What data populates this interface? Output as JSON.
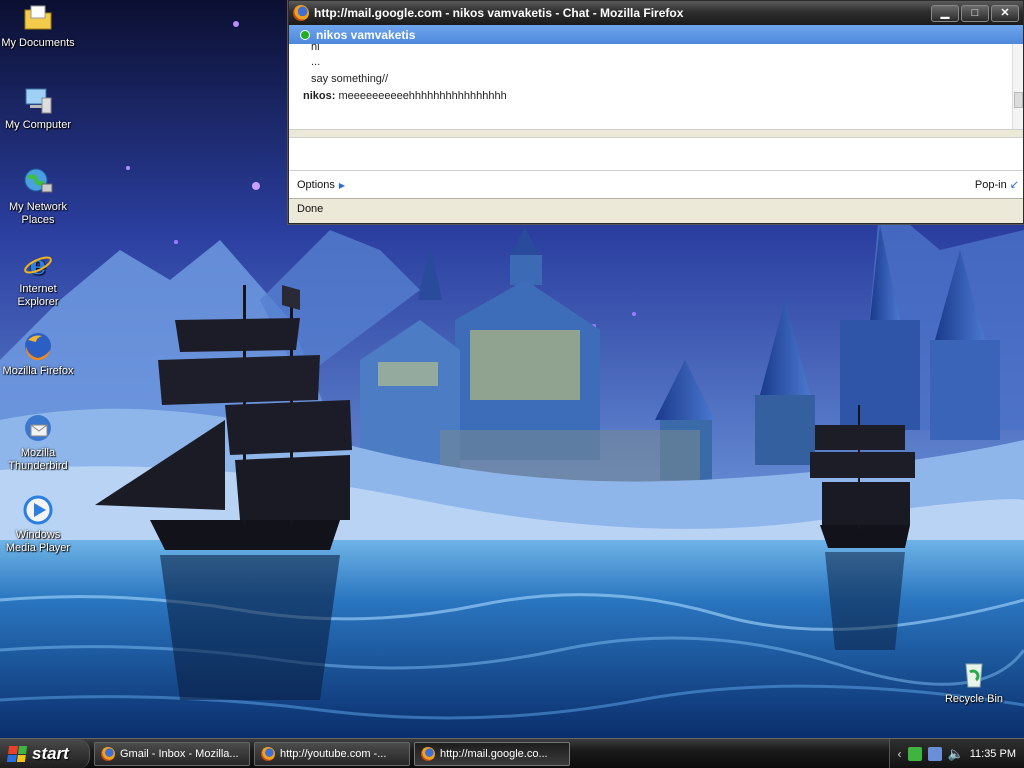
{
  "desktop": {
    "icons": [
      {
        "label": "My Documents",
        "icon": "my-documents-folder-icon"
      },
      {
        "label": "My Computer",
        "icon": "my-computer-icon"
      },
      {
        "label": "My Network Places",
        "icon": "network-places-icon"
      },
      {
        "label": "Internet Explorer",
        "icon": "internet-explorer-icon"
      },
      {
        "label": "Mozilla Firefox",
        "icon": "firefox-icon"
      },
      {
        "label": "Mozilla Thunderbird",
        "icon": "thunderbird-icon"
      },
      {
        "label": "Windows Media Player",
        "icon": "media-player-icon"
      },
      {
        "label": "Recycle Bin",
        "icon": "recycle-bin-icon"
      }
    ]
  },
  "window": {
    "title": "http://mail.google.com - nikos vamvaketis - Chat - Mozilla Firefox",
    "buttons": {
      "minimize": "▁",
      "maximize": "□",
      "close": "✕"
    },
    "chat": {
      "contact": "nikos vamvaketis",
      "status_color": "#21b021",
      "messages": [
        {
          "sender": "",
          "text": "hi"
        },
        {
          "sender": "",
          "text": "..."
        },
        {
          "sender": "",
          "text": "say something//"
        },
        {
          "sender": "nikos:",
          "text": "meeeeeeeeeehhhhhhhhhhhhhhhh"
        }
      ],
      "options_label": "Options",
      "popin_label": "Pop-in"
    },
    "status_text": "Done"
  },
  "taskbar": {
    "start_label": "start",
    "tasks": [
      {
        "label": "Gmail - Inbox - Mozilla...",
        "active": false
      },
      {
        "label": "http://youtube.com -...",
        "active": false
      },
      {
        "label": "http://mail.google.co...",
        "active": true
      }
    ],
    "clock": "11:35 PM"
  },
  "colors": {
    "chat_header": "#4d88db",
    "online": "#21b021",
    "taskbar": "#1a1a1a"
  }
}
